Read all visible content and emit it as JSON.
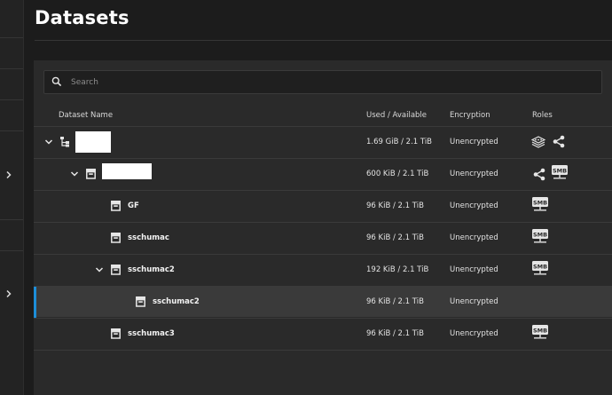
{
  "page": {
    "title": "Datasets"
  },
  "search": {
    "placeholder": "Search",
    "value": ""
  },
  "table": {
    "columns": [
      "Dataset Name",
      "Used / Available",
      "Encryption",
      "Roles"
    ],
    "rows": [
      {
        "name": "",
        "usage": "1.69 GiB / 2.1 TiB",
        "encryption": "Unencrypted",
        "roles": [
          "storage-pool-icon",
          "share-icon"
        ]
      },
      {
        "name": "",
        "usage": "600 KiB / 2.1 TiB",
        "encryption": "Unencrypted",
        "roles": [
          "share-icon",
          "smb-share-icon"
        ]
      },
      {
        "name": "GF",
        "usage": "96 KiB / 2.1 TiB",
        "encryption": "Unencrypted",
        "roles": [
          "smb-share-icon"
        ]
      },
      {
        "name": "sschumac",
        "usage": "96 KiB / 2.1 TiB",
        "encryption": "Unencrypted",
        "roles": [
          "smb-share-icon"
        ]
      },
      {
        "name": "sschumac2",
        "usage": "192 KiB / 2.1 TiB",
        "encryption": "Unencrypted",
        "roles": [
          "smb-share-icon"
        ]
      },
      {
        "name": "sschumac2",
        "usage": "96 KiB / 2.1 TiB",
        "encryption": "Unencrypted",
        "roles": []
      },
      {
        "name": "sschumac3",
        "usage": "96 KiB / 2.1 TiB",
        "encryption": "Unencrypted",
        "roles": [
          "smb-share-icon"
        ]
      }
    ]
  },
  "badges": {
    "smb": "SMB"
  },
  "colors": {
    "accent": "#1d8ed8",
    "background": "#1c1c1c",
    "card": "#2a2a2a"
  }
}
